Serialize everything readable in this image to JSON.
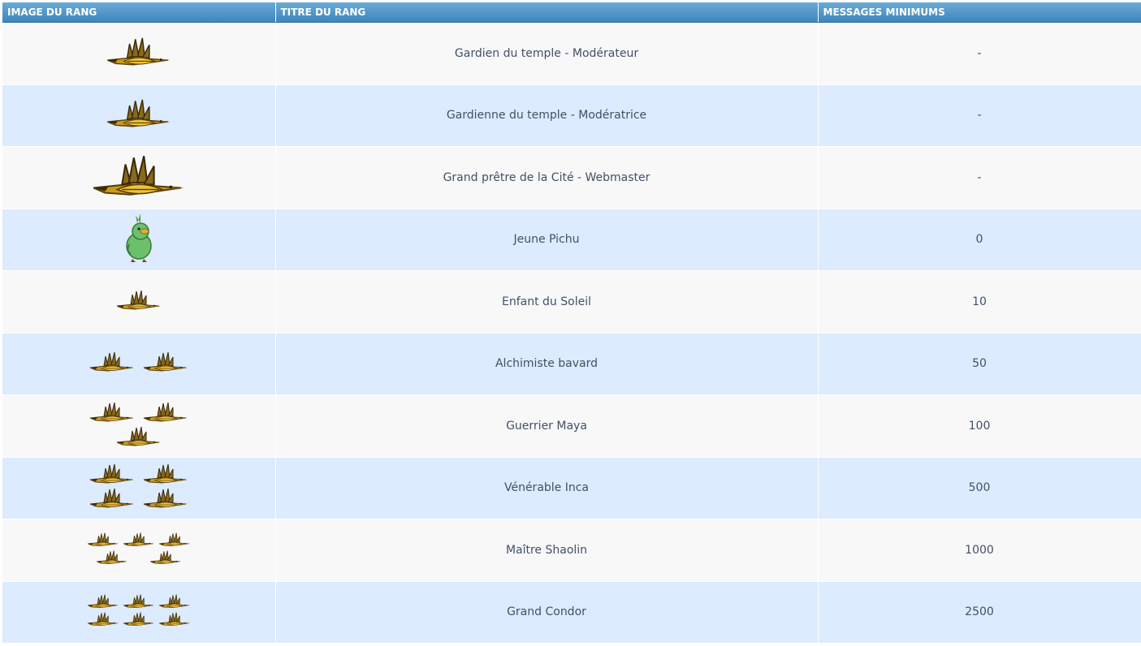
{
  "header": {
    "image_col": "IMAGE DU RANG",
    "title_col": "TITRE DU RANG",
    "min_col": "MESSAGES MINIMUMS"
  },
  "rows": [
    {
      "title": "Gardien du temple - Modérateur",
      "min": "-",
      "image": "golden-condor-icon",
      "birds": [
        1
      ],
      "size": "large"
    },
    {
      "title": "Gardienne du temple - Modératrice",
      "min": "-",
      "image": "golden-condor-icon",
      "birds": [
        1
      ],
      "size": "large"
    },
    {
      "title": "Grand prêtre de la Cité - Webmaster",
      "min": "-",
      "image": "golden-condor-icon",
      "birds": [
        1
      ],
      "size": "xlarge"
    },
    {
      "title": "Jeune Pichu",
      "min": "0",
      "image": "green-chick-icon",
      "birds": [],
      "size": "chick"
    },
    {
      "title": "Enfant du Soleil",
      "min": "10",
      "image": "golden-condor-icon",
      "birds": [
        1
      ],
      "size": "medium"
    },
    {
      "title": "Alchimiste bavard",
      "min": "50",
      "image": "golden-condor-icon",
      "birds": [
        2
      ],
      "size": "medium"
    },
    {
      "title": "Guerrier Maya",
      "min": "100",
      "image": "golden-condor-icon",
      "birds": [
        2,
        1
      ],
      "size": "medium"
    },
    {
      "title": "Vénérable Inca",
      "min": "500",
      "image": "golden-condor-icon",
      "birds": [
        2,
        2
      ],
      "size": "medium"
    },
    {
      "title": "Maître Shaolin",
      "min": "1000",
      "image": "golden-condor-icon",
      "birds": [
        3,
        2
      ],
      "size": "small"
    },
    {
      "title": "Grand Condor",
      "min": "2500",
      "image": "golden-condor-icon",
      "birds": [
        3,
        3
      ],
      "size": "small"
    }
  ],
  "colors": {
    "header_top": "#6aaad8",
    "header_bottom": "#3f86bd",
    "row_light": "#f8f8f8",
    "row_blue": "#dcebfe",
    "text": "#425067"
  }
}
